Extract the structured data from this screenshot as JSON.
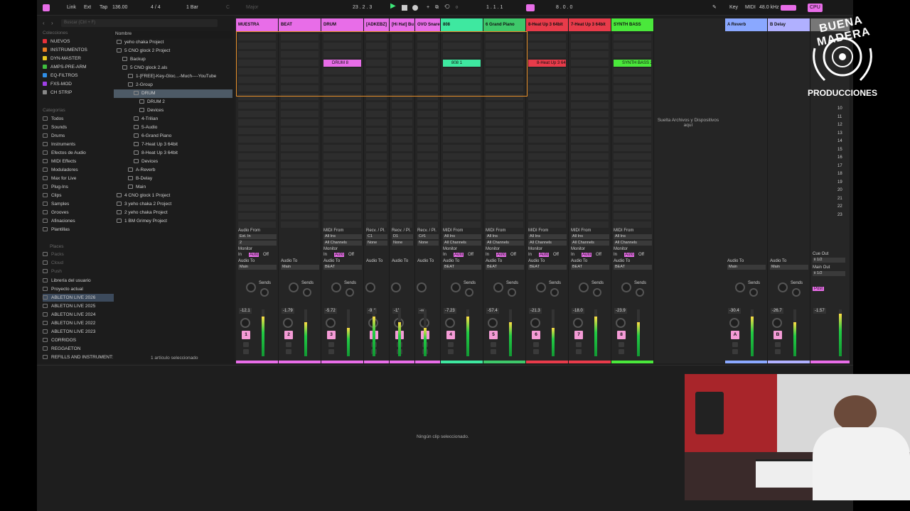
{
  "topbar": {
    "link": "Link",
    "ext": "Ext",
    "tap": "Tap",
    "tempo": "136.00",
    "signature": "4 / 4",
    "quant": "1 Bar",
    "key_c": "C",
    "scale": "Major",
    "position": "23 .  2 .  3",
    "loop_start": "1 .  1 .  1",
    "loop_len": "8 .  0 .  0",
    "key_label": "Key",
    "midi_label": "MIDI",
    "sample_rate": "48.0 kHz",
    "cpu": "CPU"
  },
  "browser": {
    "search_placeholder": "Buscar (Ctrl + F)",
    "collections_header": "Colecciones",
    "collections": [
      {
        "label": "NUEVOS",
        "color": "#e8303a"
      },
      {
        "label": "INSTRUMENTOS",
        "color": "#e87d20"
      },
      {
        "label": "DYN-MASTER",
        "color": "#e8c820"
      },
      {
        "label": "AMPS-PRE-ARM",
        "color": "#3fbf3f"
      },
      {
        "label": "EQ-FILTROS",
        "color": "#2f8fe8"
      },
      {
        "label": "FXS-MOD",
        "color": "#a040e8"
      },
      {
        "label": "CH STRIP",
        "color": "#888888"
      }
    ],
    "categories_header": "Categorías",
    "categories": [
      "Todos",
      "Sounds",
      "Drums",
      "Instruments",
      "Efectos de Audio",
      "MIDI Effects",
      "Moduladores",
      "Max for Live",
      "Plug-Ins",
      "Clips",
      "Samples",
      "Grooves",
      "Afinaciones",
      "Plantillas"
    ],
    "places_header": "Places",
    "places": [
      "Packs",
      "Cloud",
      "Push",
      "Librería del usuario",
      "Proyecto actual",
      "ABLETON LIVE 2026",
      "ABLETON LIVE 2025",
      "ABLETON LIVE 2024",
      "ABLETON LIVE 2022",
      "ABLETON LIVE  2023",
      "CORRIDOS",
      "REGGAETON",
      "REFILLS AND INSTRUMENT:"
    ],
    "name_header": "Nombre",
    "tree": [
      "yeho chaka Project",
      "5 CNO glock 2 Project",
      "Backup",
      "5 CNO glock 2.als",
      "1-[FREE]-Key-Gloc...-Much----YouTube",
      "2-Group",
      "DRUM",
      "DRUM 2",
      "Devices",
      "4-Trilian",
      "5-Audio",
      "6-Grand Piano",
      "7-Heat Up 3 64bit",
      "8-Heat Up 3 64bit",
      "Devices",
      "A-Reverb",
      "B-Delay",
      "Main",
      "4 CNO glock 1 Project",
      "3 yeho chaka 2 Project",
      "2 yeho chaka Project",
      "1 BM Grimey Project"
    ],
    "status": "1 artículo seleccionado"
  },
  "tracks": [
    {
      "name": "MUESTRA",
      "color": "#e86de8",
      "io_from": "Audio From",
      "in_sel": "Ext. In",
      "ch": "2",
      "to": "Audio To",
      "to_sel": "Main",
      "vol": "-12.1",
      "num": "1",
      "clip": ""
    },
    {
      "name": "BEAT",
      "color": "#e86de8",
      "io_from": "",
      "in_sel": "",
      "ch": "",
      "to": "Audio To",
      "to_sel": "Main",
      "vol": "-1.79",
      "num": "2",
      "clip": ""
    },
    {
      "name": "DRUM",
      "color": "#e86de8",
      "io_from": "MIDI From",
      "in_sel": "All Ins",
      "ch": "All Channels",
      "to": "Audio To",
      "to_sel": "BEAT",
      "vol": "-5.72",
      "num": "3",
      "clip": "DRUM 8"
    },
    {
      "name": "[ADKEBZ]",
      "color": "#e86de8",
      "io_from": "Recv. / Pl.",
      "in_sel": "C1",
      "ch": "None",
      "to": "Audio To",
      "to_sel": "",
      "vol": "-9.4",
      "num": "C",
      "clip": ""
    },
    {
      "name": "[Hi Hat] Bu",
      "color": "#e86de8",
      "io_from": "Recv. / Pl.",
      "in_sel": "D1",
      "ch": "None",
      "to": "Audio To",
      "to_sel": "",
      "vol": "-11",
      "num": "C",
      "clip": ""
    },
    {
      "name": "OVO Snare",
      "color": "#e86de8",
      "io_from": "Recv. / Pl.",
      "in_sel": "C#1",
      "ch": "None",
      "to": "Audio To",
      "to_sel": "",
      "vol": "-∞",
      "num": "C",
      "clip": ""
    },
    {
      "name": "808",
      "color": "#3ee8a0",
      "io_from": "MIDI From",
      "in_sel": "All Ins",
      "ch": "All Channels",
      "to": "Audio To",
      "to_sel": "BEAT",
      "vol": "-7.23",
      "num": "4",
      "clip": "808 1"
    },
    {
      "name": "6 Grand Piano",
      "color": "#3ec86a",
      "io_from": "MIDI From",
      "in_sel": "All Ins",
      "ch": "All Channels",
      "to": "Audio To",
      "to_sel": "BEAT",
      "vol": "-57.4",
      "num": "5",
      "clip": ""
    },
    {
      "name": "8-Heat Up 3 64bit",
      "color": "#e83b4a",
      "io_from": "MIDI From",
      "in_sel": "All Ins",
      "ch": "All Channels",
      "to": "Audio To",
      "to_sel": "BEAT",
      "vol": "-21.3",
      "num": "6",
      "clip": "8-Heat Up 3 64"
    },
    {
      "name": "7-Heat Up 3 64bit",
      "color": "#e83b4a",
      "io_from": "MIDI From",
      "in_sel": "All Ins",
      "ch": "All Channels",
      "to": "Audio To",
      "to_sel": "BEAT",
      "vol": "-18.0",
      "num": "7",
      "clip": ""
    },
    {
      "name": "SYNTH BASS",
      "color": "#4ae83b",
      "io_from": "MIDI From",
      "in_sel": "All Ins",
      "ch": "All Channels",
      "to": "Audio To",
      "to_sel": "BEAT",
      "vol": "-23.9",
      "num": "8",
      "clip": "SYNTH BASS 2"
    }
  ],
  "returns": [
    {
      "name": "A Reverb",
      "color": "#8aa8ff",
      "to": "Audio To",
      "to_sel": "Main",
      "vol": "-30.4",
      "num": "A"
    },
    {
      "name": "B Delay",
      "color": "#b0b0ff",
      "to": "Audio To",
      "to_sel": "Main",
      "vol": "-26.7",
      "num": "B"
    }
  ],
  "master": {
    "cue_out": "Cue Out",
    "cue_sel": "ii 1/2",
    "main_out": "Main Out",
    "main_sel": "ii 1/2",
    "vol": "-1.57",
    "post": "Post"
  },
  "labels": {
    "sends": "Sends",
    "monitor": "Monitor",
    "in": "In",
    "auto": "Auto",
    "off": "Off",
    "drop_hint": "Suelta Archivos y Dispositivos aquí"
  },
  "scene_numbers": [
    "10",
    "11",
    "12",
    "13",
    "14",
    "15",
    "16",
    "17",
    "18",
    "19",
    "20",
    "21",
    "22",
    "23"
  ],
  "detail": {
    "empty": "Ningún clip seleccionado."
  },
  "logo": {
    "line1": "BUENA MADERA",
    "line2": "PRODUCCIONES"
  }
}
